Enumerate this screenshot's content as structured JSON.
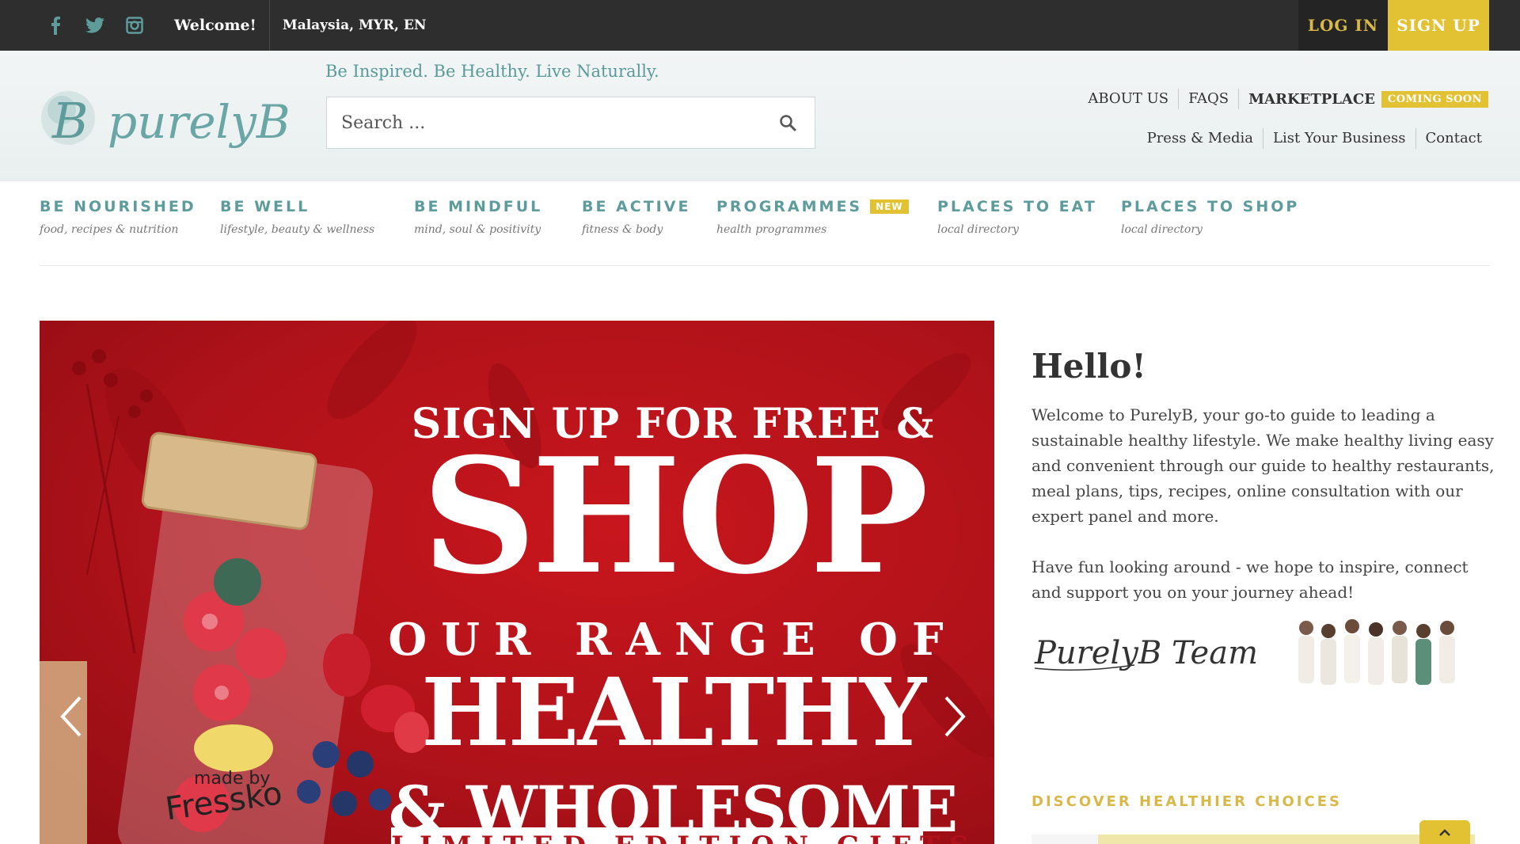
{
  "topbar": {
    "social": [
      "facebook-icon",
      "twitter-icon",
      "instagram-icon"
    ],
    "welcome": "Welcome!",
    "locale": "Malaysia, MYR, EN",
    "login": "LOG IN",
    "signup": "SIGN UP"
  },
  "header": {
    "logo_text": "purelyB",
    "tagline": "Be Inspired. Be Healthy. Live Naturally.",
    "search_placeholder": "Search ...",
    "links": [
      "ABOUT US",
      "FAQS",
      "MARKETPLACE"
    ],
    "coming_soon": "COMING SOON",
    "sublinks": [
      "Press & Media",
      "List Your Business",
      "Contact"
    ]
  },
  "nav": [
    {
      "title": "BE NOURISHED",
      "sub": "food, recipes & nutrition"
    },
    {
      "title": "BE WELL",
      "sub": "lifestyle, beauty & wellness"
    },
    {
      "title": "BE MINDFUL",
      "sub": "mind, soul & positivity"
    },
    {
      "title": "BE ACTIVE",
      "sub": "fitness & body"
    },
    {
      "title": "PROGRAMMES",
      "sub": "health programmes",
      "badge": "NEW"
    },
    {
      "title": "PLACES TO EAT",
      "sub": "local directory"
    },
    {
      "title": "PLACES TO SHOP",
      "sub": "local directory"
    }
  ],
  "banner": {
    "line1": "SIGN UP FOR FREE &",
    "line2": "SHOP",
    "line3": "OUR RANGE OF",
    "line4": "HEALTHY",
    "line5": "& WHOLESOME",
    "line6": "LIMITED EDITION GIFTS",
    "bottle_brand_1": "made by",
    "bottle_brand_2": "Fressko",
    "colors": {
      "background": "#b0121a",
      "text": "#ffffff"
    }
  },
  "welcome_panel": {
    "title": "Hello!",
    "intro": "Welcome to PurelyB, your go-to guide to leading a sustainable healthy lifestyle. We make healthy living easy and convenient through our guide to healthy restaurants, meal plans, tips, recipes, online consultation with our expert panel and more.",
    "intro2": "Have fun looking around - we hope to inspire, connect and support you on your journey ahead!",
    "signature": "PurelyB Team",
    "discover": "DISCOVER HEALTHIER CHOICES"
  },
  "colors": {
    "accent": "#e2c232",
    "teal": "#5d9c9b",
    "topbar": "#2e2e2e"
  }
}
